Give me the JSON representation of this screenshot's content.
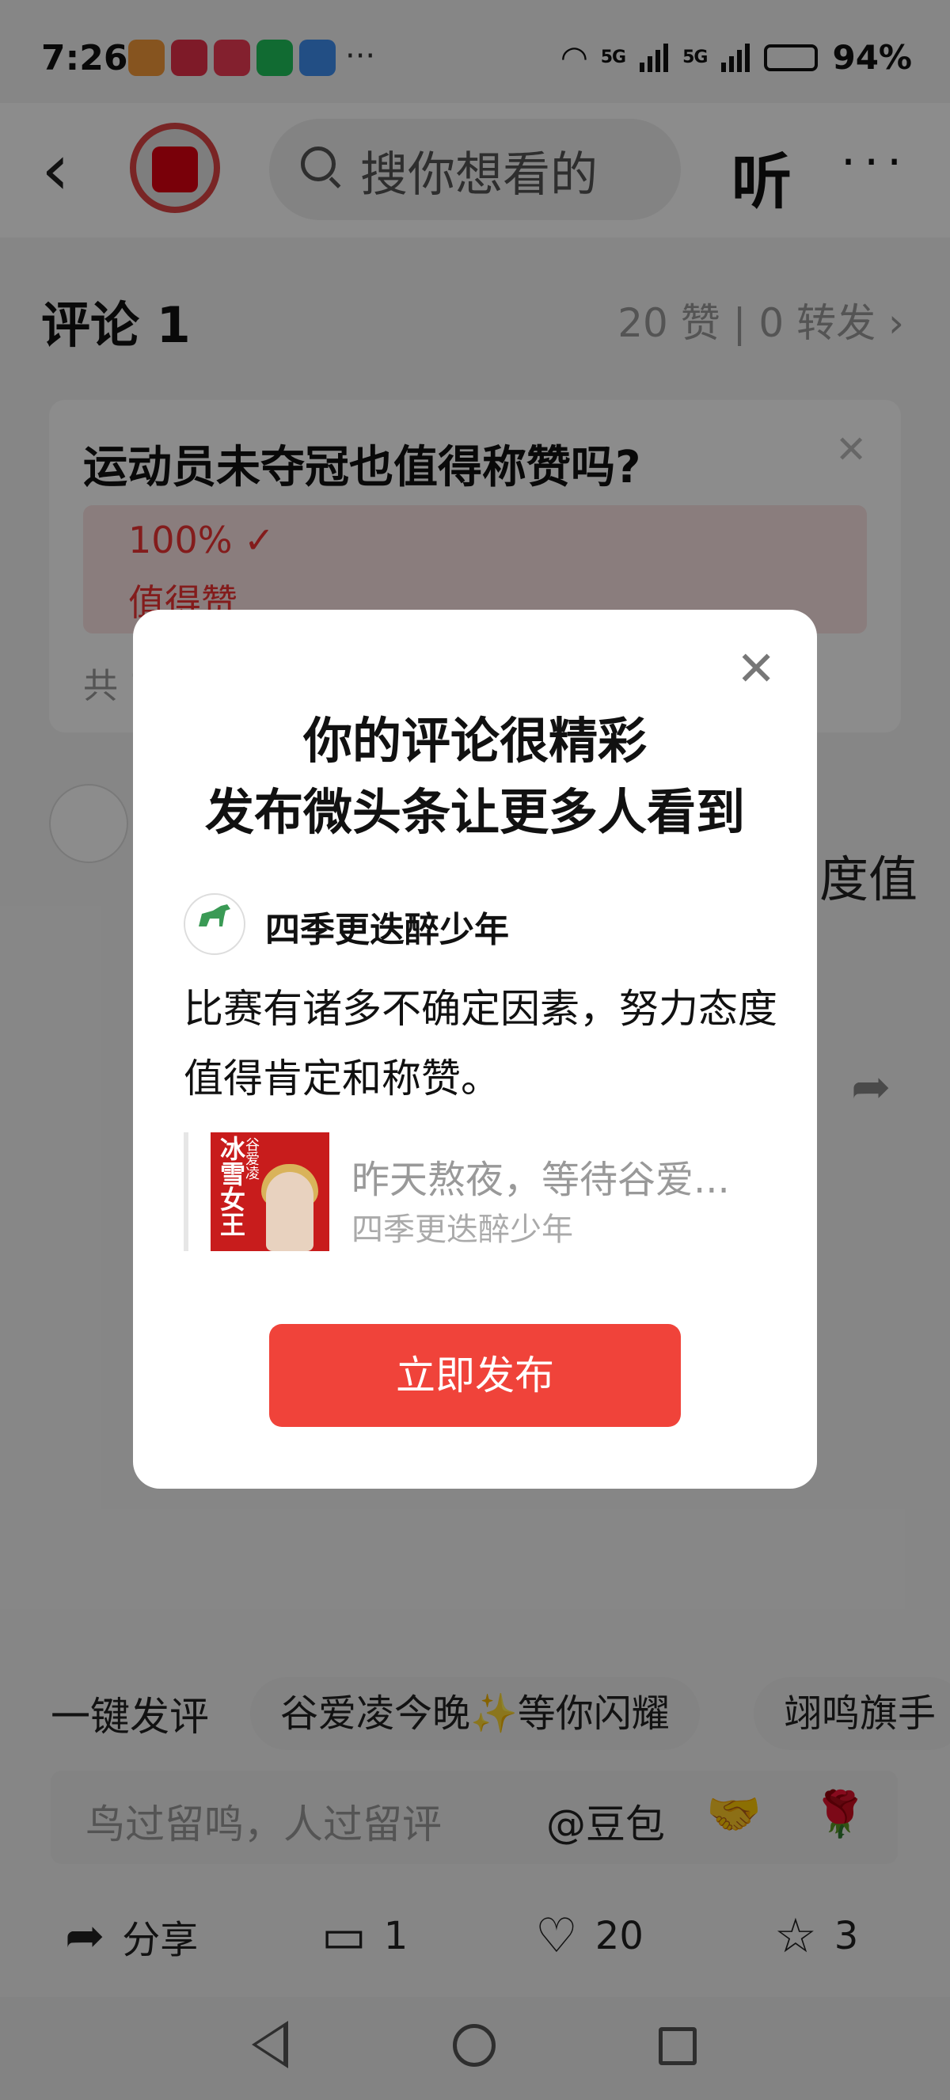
{
  "status_bar": {
    "time": "7:26",
    "more": "···",
    "network_1": "5G",
    "network_2": "5G",
    "battery": "94%"
  },
  "header": {
    "search_placeholder": "搜你想看的",
    "listen_label": "听",
    "more_label": "···"
  },
  "comments": {
    "title": "评论 1",
    "stats": "20 赞 | 0 转发",
    "trail_text": "度值"
  },
  "poll": {
    "question": "运动员未夺冠也值得称赞吗?",
    "percent": "100% ✓",
    "option": "值得赞",
    "footer": "共 1"
  },
  "modal": {
    "title_line1": "你的评论很精彩",
    "title_line2": "发布微头条让更多人看到",
    "author": "四季更迭醉少年",
    "body": "比赛有诸多不确定因素，努力态度值得肯定和称赞。",
    "quote_title": "昨天熬夜，等待谷爱...",
    "quote_author": "四季更迭醉少年",
    "thumb_text": "冰雪女王",
    "thumb_name": "谷爱凌",
    "publish_label": "立即发布",
    "close_label": "✕"
  },
  "quick_comments": {
    "lead": "一键发评",
    "chips": [
      "谷爱凌今晚✨等你闪耀",
      "翊鸣旗手"
    ]
  },
  "input": {
    "placeholder": "鸟过留鸣，人过留评",
    "at_label": "@豆包",
    "emoji_1": "🤝",
    "emoji_2": "🌹"
  },
  "actions": {
    "share": "分享",
    "comments": "1",
    "likes": "20",
    "favorites": "3"
  },
  "colors": {
    "accent": "#f0433a",
    "poll_red": "#e33333"
  }
}
